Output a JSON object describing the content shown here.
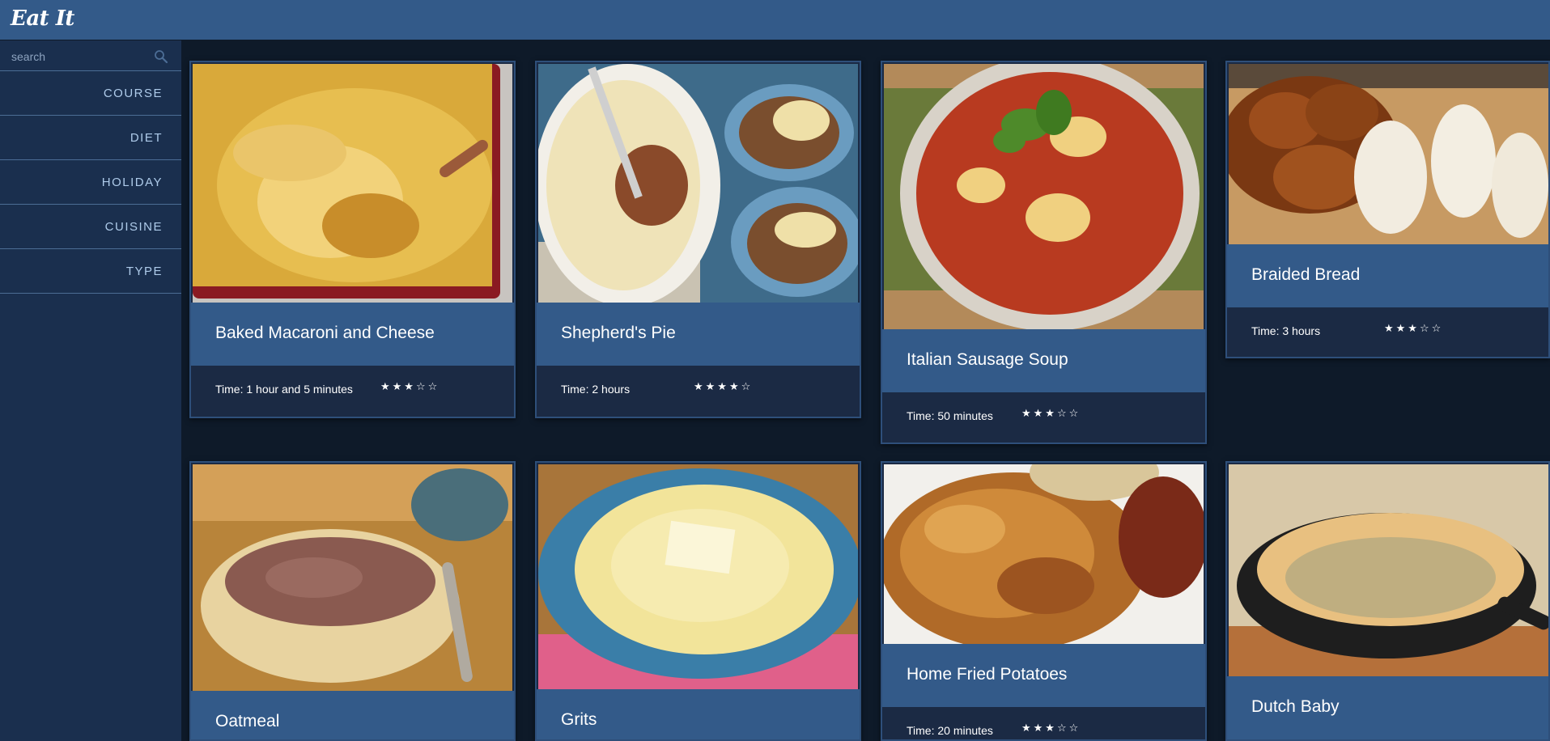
{
  "app": {
    "title": "Eat It"
  },
  "search": {
    "placeholder": "search",
    "icon": "search-icon"
  },
  "sidebar": {
    "items": [
      {
        "label": "COURSE"
      },
      {
        "label": "DIET"
      },
      {
        "label": "HOLIDAY"
      },
      {
        "label": "CUISINE"
      },
      {
        "label": "TYPE"
      }
    ]
  },
  "recipes": [
    {
      "title": "Baked Macaroni and Cheese",
      "time": "Time: 1 hour and 5 minutes",
      "rating": 3,
      "stars": "★★★☆☆"
    },
    {
      "title": "Shepherd's Pie",
      "time": "Time: 2 hours",
      "rating": 4,
      "stars": "★★★★☆"
    },
    {
      "title": "Italian Sausage Soup",
      "time": "Time: 50 minutes",
      "rating": 3,
      "stars": "★★★☆☆"
    },
    {
      "title": "Braided Bread",
      "time": "Time: 3 hours",
      "rating": 3,
      "stars": "★★★☆☆"
    },
    {
      "title": "Oatmeal"
    },
    {
      "title": "Grits"
    },
    {
      "title": "Home Fried Potatoes",
      "time": "Time: 20 minutes",
      "rating": 3,
      "stars": "★★★☆☆"
    },
    {
      "title": "Dutch Baby"
    }
  ],
  "colors": {
    "header": "#335a89",
    "sidebar": "#1a2f4e",
    "background": "#0e1a29",
    "card_footer": "#1b2a44",
    "nav_text": "#aecbea"
  }
}
